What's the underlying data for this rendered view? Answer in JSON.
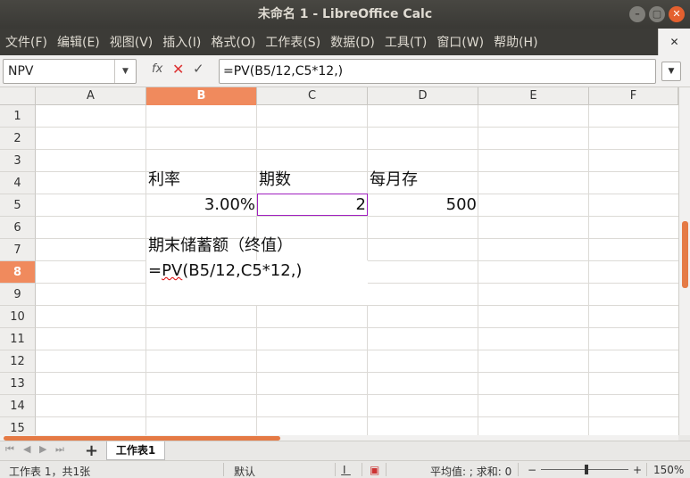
{
  "window": {
    "title": "未命名 1 - LibreOffice Calc",
    "min": "–",
    "max": "▢",
    "close": "✕"
  },
  "menu": [
    "文件(F)",
    "编辑(E)",
    "视图(V)",
    "插入(I)",
    "格式(O)",
    "工作表(S)",
    "数据(D)",
    "工具(T)",
    "窗口(W)",
    "帮助(H)"
  ],
  "menu_close": "✕",
  "formula_bar": {
    "name_box": "NPV",
    "fx": "fx",
    "cancel": "✕",
    "accept": "✓",
    "formula": "=PV(B5/12,C5*12,)",
    "dropdown": "▼"
  },
  "columns": [
    "A",
    "B",
    "C",
    "D",
    "E",
    "F"
  ],
  "active_column": "B",
  "rows": [
    "1",
    "2",
    "3",
    "4",
    "5",
    "6",
    "7",
    "8",
    "9",
    "10",
    "11",
    "12",
    "13",
    "14",
    "15"
  ],
  "active_row": "8",
  "cells": {
    "B4": "利率",
    "C4": "期数",
    "D4": "每月存",
    "B5": "3.00%",
    "C5": "2",
    "D5": "500",
    "B7": "期末储蓄额（终值）",
    "B8_pv": "PV",
    "B8_eq": "=",
    "B8_rest": "(B5/12,C5*12,)"
  },
  "tabs": {
    "nav": [
      "⏮",
      "◀",
      "▶",
      "⏭"
    ],
    "add": "+",
    "sheet": "工作表1"
  },
  "status": {
    "sheet_info": "工作表 1，共1张",
    "style": "默认",
    "insert_mode": "I͟",
    "sum": "平均值: ; 求和: 0",
    "zoom_minus": "−",
    "zoom_plus": "+",
    "zoom": "150%"
  }
}
